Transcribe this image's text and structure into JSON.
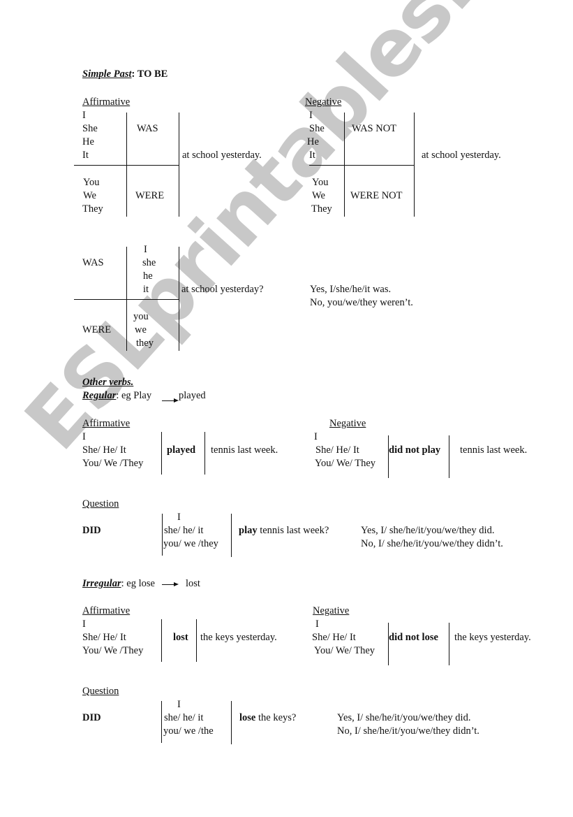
{
  "watermark": "ESLprintables.com",
  "title": {
    "main": "Simple Past",
    "rest": ": TO BE"
  },
  "to_be": {
    "affirmative": {
      "label": "Affirmative",
      "group1_pronouns": [
        "I",
        "She",
        "He",
        "It"
      ],
      "group1_verb": "WAS",
      "group2_pronouns": [
        "You",
        "We",
        "They"
      ],
      "group2_verb": "WERE",
      "complement": "at school yesterday."
    },
    "negative": {
      "label": "Negative",
      "group1_pronouns": [
        "I",
        "She",
        "He",
        "It"
      ],
      "group1_verb": "WAS NOT",
      "group2_pronouns": [
        "You",
        "We",
        "They"
      ],
      "group2_verb": "WERE NOT",
      "complement": "at school yesterday."
    },
    "question": {
      "group1_verb": "WAS",
      "group1_pronouns": [
        "I",
        "she",
        "he",
        "it"
      ],
      "group2_verb": "WERE",
      "group2_pronouns": [
        "you",
        "we",
        "they"
      ],
      "complement": "at school yesterday?",
      "answers": [
        "Yes, I/she/he/it was.",
        "No, you/we/they weren’t."
      ]
    }
  },
  "other_verbs": {
    "heading": "Other verbs.",
    "regular": {
      "label": "Regular",
      "example_prefix": ": eg Play",
      "example_result": "played",
      "affirmative": {
        "label": "Affirmative",
        "pronouns": [
          "I",
          "She/ He/ It",
          "You/ We /They"
        ],
        "verb": "played",
        "complement": "tennis last week."
      },
      "negative": {
        "label": "Negative",
        "pronouns": [
          "I",
          "She/ He/ It",
          "You/ We/ They"
        ],
        "verb": "did not play",
        "complement": "tennis last week."
      },
      "question": {
        "label": "Question",
        "aux": "DID",
        "pronouns": [
          "I",
          "she/ he/ it",
          "you/ we /they"
        ],
        "verb": "play",
        "complement": " tennis last week?",
        "answers": [
          "Yes, I/ she/he/it/you/we/they did.",
          "No, I/ she/he/it/you/we/they didn’t."
        ]
      }
    },
    "irregular": {
      "label": "Irregular",
      "example_prefix": ": eg lose",
      "example_result": "lost",
      "affirmative": {
        "label": "Affirmative",
        "pronouns": [
          "I",
          "She/ He/ It",
          "You/ We /They"
        ],
        "verb": "lost",
        "complement": "the keys yesterday."
      },
      "negative": {
        "label": "Negative",
        "pronouns": [
          "I",
          "She/ He/ It",
          "You/ We/ They"
        ],
        "verb": "did not lose",
        "complement": "the keys yesterday."
      },
      "question": {
        "label": "Question",
        "aux": "DID",
        "pronouns": [
          "I",
          "she/ he/ it",
          "you/ we /the"
        ],
        "verb": "lose",
        "complement": " the keys?",
        "answers": [
          "Yes, I/ she/he/it/you/we/they did.",
          "No, I/ she/he/it/you/we/they didn’t."
        ]
      }
    }
  }
}
